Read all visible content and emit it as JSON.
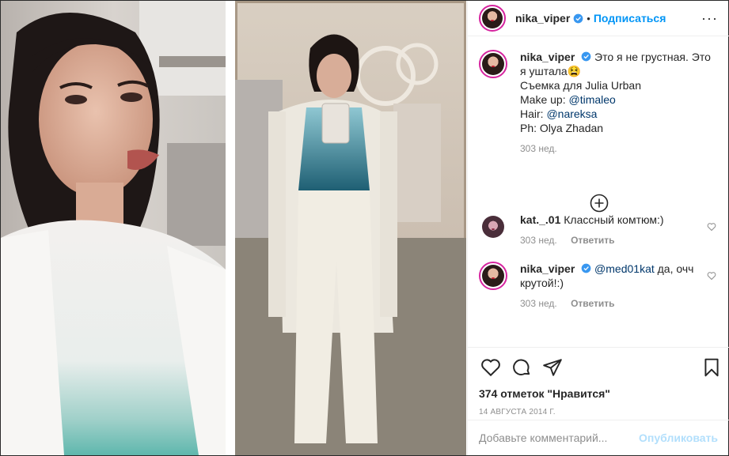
{
  "post": {
    "photo_alt": "",
    "username": "nika_viper",
    "follow_label": "Подписаться",
    "dot": "•",
    "more": "···",
    "caption": {
      "username": "nika_viper",
      "line1": "Это я не грустная. Это я уштала",
      "emoji": "😫",
      "line2": "Съемка для Julia Urban",
      "makeup_label": "Make up: ",
      "makeup_link": "@timaleo",
      "hair_label": "Hair: ",
      "hair_link": "@nareksa",
      "ph": "Ph: Olya Zhadan",
      "time": "303 нед."
    },
    "comments": [
      {
        "username": "kat._.01",
        "text": "Классный комтюм:)",
        "time": "303 нед.",
        "reply": "Ответить"
      },
      {
        "username": "nika_viper",
        "mention": "@med01kat",
        "text": " да, очч крутой!:)",
        "time": "303 нед.",
        "reply": "Ответить"
      }
    ],
    "likes": "374 отметок \"Нравится\"",
    "date": "14 августа 2014 г.",
    "add_comment_placeholder": "Добавьте комментарий...",
    "publish_label": "Опубликовать"
  },
  "colors": {
    "accent": "#0095f6",
    "verified": "#3897f0",
    "muted": "#8e8e8e",
    "publish_disabled": "#b2dffc"
  },
  "icons": [
    "verified-badge-icon",
    "more-options-icon",
    "plus-circle-icon",
    "heart-icon",
    "comment-icon",
    "share-icon",
    "bookmark-icon"
  ]
}
